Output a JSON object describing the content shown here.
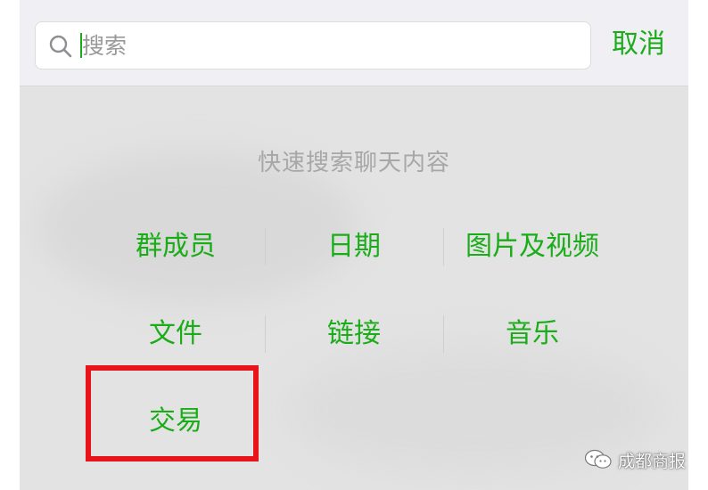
{
  "search": {
    "placeholder": "搜索",
    "value": "",
    "cancel_label": "取消"
  },
  "hint": "快速搜索聊天内容",
  "categories": [
    [
      "群成员",
      "日期",
      "图片及视频"
    ],
    [
      "文件",
      "链接",
      "音乐"
    ],
    [
      "交易"
    ]
  ],
  "highlighted_category": "交易",
  "watermark": {
    "text": "成都商报",
    "icon": "wechat-icon"
  },
  "colors": {
    "accent": "#1aad19",
    "highlight_border": "#e8141a",
    "hint_text": "#a7a7a7",
    "background": "#e3e3e3"
  }
}
